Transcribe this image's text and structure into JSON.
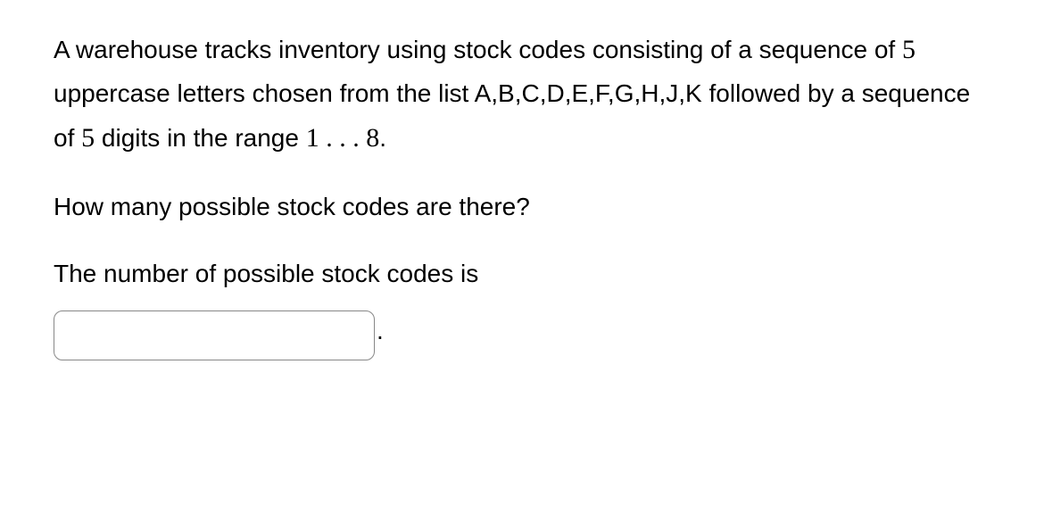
{
  "problem": {
    "paragraph_parts": {
      "p1a": "A warehouse tracks inventory using stock codes consisting of a sequence of ",
      "p1_num1": "5",
      "p1b": " uppercase letters chosen from the list A,B,C,D,E,F,G,H,J,K followed by a sequence of ",
      "p1_num2": "5",
      "p1c": " digits in the range ",
      "p1_range_a": "1",
      "p1_dots": " . . . ",
      "p1_range_b": "8",
      "p1d": "."
    },
    "question": "How many possible stock codes are there?",
    "answer_label": "The number of possible stock codes is",
    "answer_value": "",
    "period": "."
  }
}
